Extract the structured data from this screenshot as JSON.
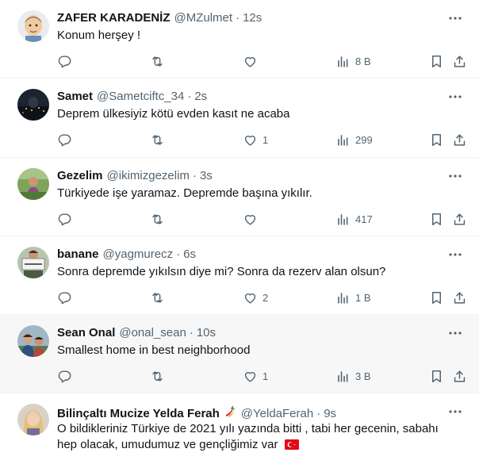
{
  "tweets": [
    {
      "name": "ZAFER KARADENİZ",
      "handle": "@MZulmet",
      "time": "12s",
      "text": "Konum herşey !",
      "replies": "",
      "retweets": "",
      "likes": "",
      "views": "8 B",
      "avatar": "memoji-avatar"
    },
    {
      "name": "Samet",
      "handle": "@Sametciftc_34",
      "time": "2s",
      "text": "Deprem ülkesiyiz kötü evden kasıt ne acaba",
      "replies": "",
      "retweets": "",
      "likes": "1",
      "views": "299",
      "avatar": "night-city-avatar"
    },
    {
      "name": "Gezelim",
      "handle": "@ikimizgezelim",
      "time": "3s",
      "text": "Türkiyede işe yaramaz. Depremde başına yıkılır.",
      "replies": "",
      "retweets": "",
      "likes": "",
      "views": "417",
      "avatar": "nature-avatar"
    },
    {
      "name": "banane",
      "handle": "@yagmurecz",
      "time": "6s",
      "text": "Sonra depremde yıkılsın diye mi? Sonra da rezerv alan olsun?",
      "replies": "",
      "retweets": "",
      "likes": "2",
      "views": "1 B",
      "avatar": "sign-avatar"
    },
    {
      "name": "Sean Onal",
      "handle": "@onal_sean",
      "time": "10s",
      "text": "Smallest home in best neighborhood",
      "replies": "",
      "retweets": "",
      "likes": "1",
      "views": "3 B",
      "avatar": "two-people-avatar"
    },
    {
      "name": "Bilinçaltı Mucize Yelda Ferah",
      "handle": "@YeldaFerah",
      "time": "9s",
      "text": "O bildikleriniz Türkiye de 2021 yılı yazında bitti , tabi her gecenin, sabahı hep olacak, umudumuz ve gençliğimiz var",
      "replies": "",
      "retweets": "",
      "likes": "",
      "views": "",
      "avatar": "blonde-woman-avatar",
      "name_emoji": "chili-pepper-icon",
      "text_emoji": "turkey-flag-icon"
    }
  ],
  "colors": {
    "text_primary": "#0f1419",
    "text_secondary": "#536471",
    "divider": "#eff3f4",
    "hover_background": "#f7f7f7",
    "flag_red": "#e30a17"
  }
}
